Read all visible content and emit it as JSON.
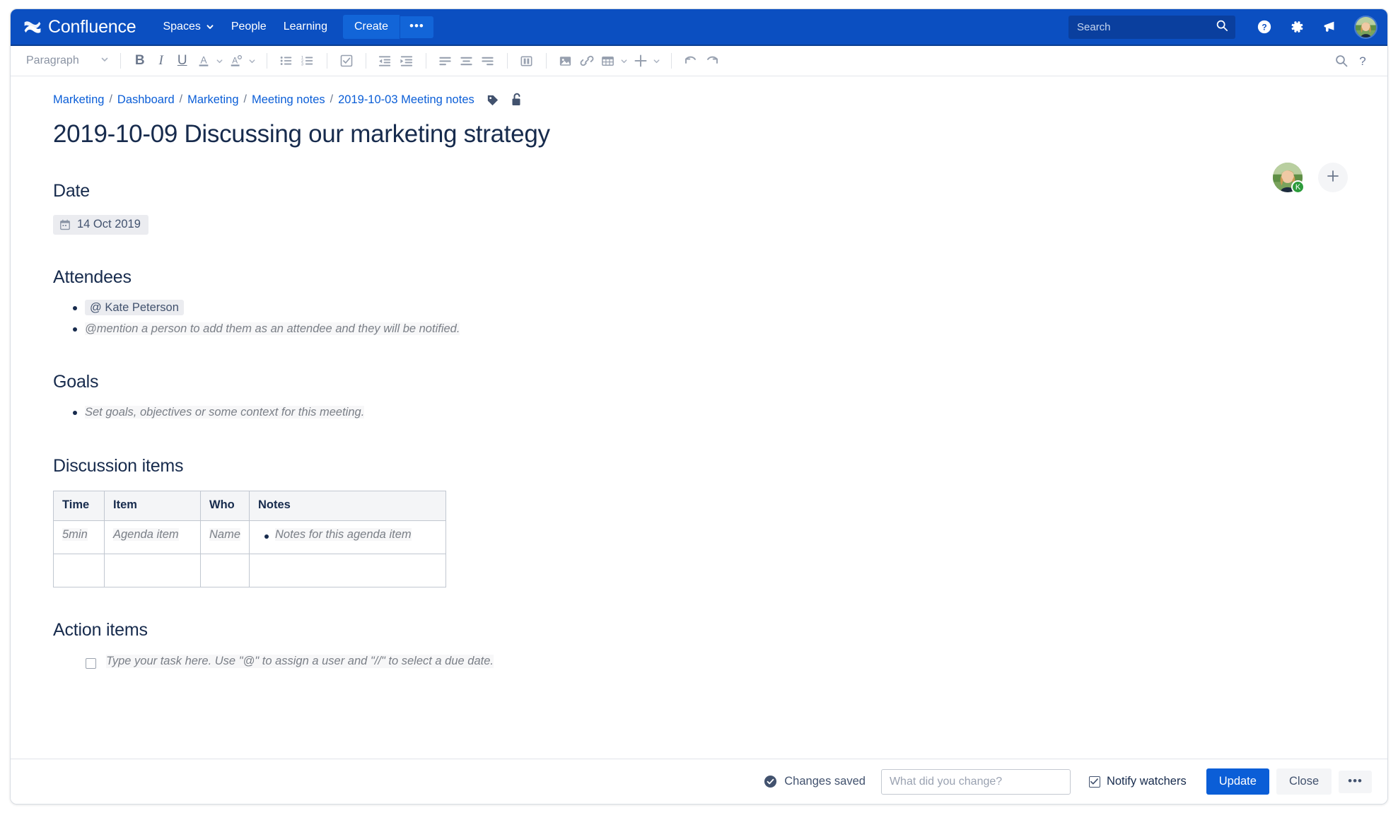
{
  "colors": {
    "nav_bg": "#0b4fc1",
    "accent": "#0b5ed7",
    "link": "#0b5ed7",
    "text": "#172b4d",
    "muted": "#6b778c",
    "chip_bg": "#ebecf0",
    "badge_green": "#2c9b3b"
  },
  "topnav": {
    "brand": "Confluence",
    "brand_logo_icon": "confluence-logo-icon",
    "links": [
      {
        "label": "Spaces",
        "has_caret": true,
        "caret_icon": "chevron-down-icon"
      },
      {
        "label": "People",
        "has_caret": false
      },
      {
        "label": "Learning",
        "has_caret": false
      }
    ],
    "create_label": "Create",
    "create_more_label": "•••",
    "search": {
      "placeholder": "Search",
      "value": "",
      "icon": "search-icon"
    },
    "icons": [
      {
        "name": "help-icon",
        "glyph": "?"
      },
      {
        "name": "settings-gear-icon",
        "glyph": "gear"
      },
      {
        "name": "notifications-megaphone-icon",
        "glyph": "megaphone"
      }
    ],
    "avatar_name": "user-avatar"
  },
  "toolbar": {
    "style_select": {
      "label": "Paragraph",
      "caret_icon": "chevron-down-icon"
    },
    "buttons": [
      {
        "name": "bold-button",
        "label": "B"
      },
      {
        "name": "italic-button",
        "label": "I"
      },
      {
        "name": "underline-button",
        "label": "U"
      },
      {
        "name": "text-color-button",
        "label": "A",
        "caret": true
      },
      {
        "name": "highlight-color-button",
        "label": "A",
        "caret": true
      },
      {
        "name": "bullet-list-button"
      },
      {
        "name": "numbered-list-button"
      },
      {
        "name": "task-list-button"
      },
      {
        "name": "outdent-button"
      },
      {
        "name": "indent-button"
      },
      {
        "name": "align-left-button"
      },
      {
        "name": "align-center-button"
      },
      {
        "name": "align-right-button"
      },
      {
        "name": "page-layout-button"
      },
      {
        "name": "insert-image-button"
      },
      {
        "name": "insert-link-button"
      },
      {
        "name": "insert-table-button",
        "caret": true
      },
      {
        "name": "insert-more-button",
        "caret": true
      },
      {
        "name": "undo-button"
      },
      {
        "name": "redo-button"
      }
    ],
    "right_buttons": [
      {
        "name": "find-replace-button",
        "glyph": "search"
      },
      {
        "name": "editor-help-button",
        "glyph": "?"
      }
    ]
  },
  "breadcrumb": {
    "items": [
      "Marketing",
      "Dashboard",
      "Marketing",
      "Meeting notes",
      "2019-10-03 Meeting notes"
    ],
    "separator": "/",
    "label_icon": "tag-icon",
    "restrictions_icon": "unlocked-padlock-icon"
  },
  "page_actions": {
    "avatar_badge_letter": "K",
    "add_button_icon": "plus-icon"
  },
  "document": {
    "title": "2019-10-09 Discussing our marketing strategy",
    "sections": {
      "date": {
        "heading": "Date",
        "chip_icon": "calendar-icon",
        "chip_value": "14 Oct 2019"
      },
      "attendees": {
        "heading": "Attendees",
        "items": [
          {
            "type": "mention",
            "text": "@ Kate Peterson"
          },
          {
            "type": "placeholder",
            "text": "@mention a person to add them as an attendee and they will be notified."
          }
        ]
      },
      "goals": {
        "heading": "Goals",
        "items": [
          {
            "type": "placeholder",
            "text": "Set goals, objectives or some context for this meeting."
          }
        ]
      },
      "discussion": {
        "heading": "Discussion items",
        "columns": [
          "Time",
          "Item",
          "Who",
          "Notes"
        ],
        "rows": [
          {
            "time": "5min",
            "item": "Agenda item",
            "who": "Name",
            "notes": "Notes for this agenda item",
            "placeholder": true
          },
          {
            "time": "",
            "item": "",
            "who": "",
            "notes": "",
            "placeholder": false
          }
        ]
      },
      "action_items": {
        "heading": "Action items",
        "task_placeholder": "Type your task here. Use \"@\" to assign a user and \"//\" to select a due date.",
        "task_checked": false
      }
    }
  },
  "footer": {
    "status": "Changes saved",
    "status_icon": "check-circle-icon",
    "change_comment": {
      "placeholder": "What did you change?",
      "value": ""
    },
    "notify_watchers": {
      "label": "Notify watchers",
      "checked": true
    },
    "update_label": "Update",
    "close_label": "Close",
    "more_label": "•••"
  }
}
